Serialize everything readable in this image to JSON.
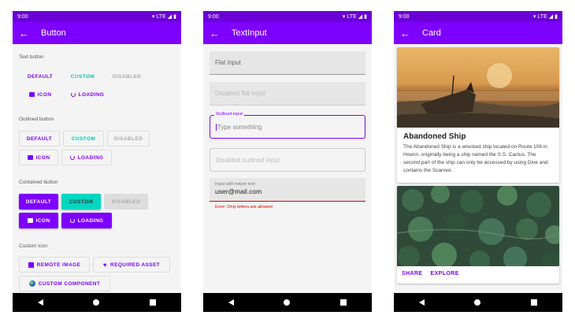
{
  "screens": [
    {
      "status_time": "9:00",
      "status_net": "LTE",
      "title": "Button"
    },
    {
      "status_time": "9:00",
      "status_net": "LTE",
      "title": "TextInput"
    },
    {
      "status_time": "9:00",
      "status_net": "LTE",
      "title": "Card"
    }
  ],
  "button_screen": {
    "text_section": "Text button",
    "outlined_section": "Outlined button",
    "contained_section": "Contained button",
    "custom_icon_section": "Custom icon",
    "default": "DEFAULT",
    "custom": "CUSTOM",
    "disabled": "DISABLED",
    "icon": "ICON",
    "loading": "LOADING",
    "remote_image": "REMOTE IMAGE",
    "required_asset": "REQUIRED ASSET",
    "custom_component": "CUSTOM COMPONENT"
  },
  "textinput_screen": {
    "flat_placeholder": "Flat input",
    "disabled_flat_placeholder": "Disabled flat input",
    "outlined_label": "Outlined input",
    "outlined_placeholder": "Type something",
    "disabled_outlined_placeholder": "Disabled outlined input",
    "helper_label": "Input with helper text",
    "helper_value": "user@mail.com",
    "error_text": "Error: Only letters are allowed"
  },
  "card_screen": {
    "card_title": "Abandoned Ship",
    "card_body": "The Abandoned Ship is a wrecked ship located on Route 108 in Hoenn, originally being a ship named the S.S. Cactus. The second part of the ship can only be accessed by using Dive and contains the Scanner.",
    "share": "SHARE",
    "explore": "EXPLORE"
  },
  "colors": {
    "primary": "#7e00ff",
    "status_bar": "#6a00d6",
    "accent": "#00c9b1",
    "error": "#d50000"
  }
}
